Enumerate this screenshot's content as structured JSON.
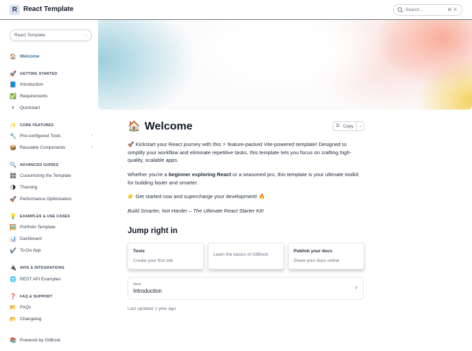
{
  "header": {
    "logo_letter": "R",
    "title": "React Template",
    "search_placeholder": "Search...",
    "search_shortcut": "⌘ K"
  },
  "sidebar": {
    "space_select": "React Template",
    "items": [
      {
        "icon": "🏠",
        "label": "Welcome",
        "type": "page",
        "active": true
      },
      {
        "icon": "🚀",
        "label": "GETTING STARTED",
        "type": "section"
      },
      {
        "icon": "📘",
        "label": "Introduction",
        "type": "page"
      },
      {
        "icon": "✅",
        "label": "Requirements",
        "type": "page"
      },
      {
        "icon": "⚡",
        "label": "Quickstart",
        "type": "page"
      },
      {
        "icon": "✨",
        "label": "CORE FEATURES",
        "type": "section"
      },
      {
        "icon": "🔧",
        "label": "Pre-configured Tools",
        "type": "page",
        "expandable": true
      },
      {
        "icon": "📦",
        "label": "Reusable Components",
        "type": "page",
        "expandable": true
      },
      {
        "icon": "🔍",
        "label": "ADVANCED GUIDES",
        "type": "section"
      },
      {
        "icon": "🎛️",
        "label": "Customizing the Template",
        "type": "page"
      },
      {
        "icon": "🌗",
        "label": "Theming",
        "type": "page"
      },
      {
        "icon": "🚀",
        "label": "Performance Optimization",
        "type": "page"
      },
      {
        "icon": "💡",
        "label": "EXAMPLES & USE CASES",
        "type": "section"
      },
      {
        "icon": "🖼️",
        "label": "Portfolio Template",
        "type": "page"
      },
      {
        "icon": "📊",
        "label": "Dashboard",
        "type": "page"
      },
      {
        "icon": "✔️",
        "label": "To-Do App",
        "type": "page"
      },
      {
        "icon": "🔌",
        "label": "APIS & INTEGRATIONS",
        "type": "section"
      },
      {
        "icon": "🌐",
        "label": "REST API Examples",
        "type": "page"
      },
      {
        "icon": "❓",
        "label": "FAQ & SUPPORT",
        "type": "section"
      },
      {
        "icon": "📂",
        "label": "FAQs",
        "type": "page"
      },
      {
        "icon": "📂",
        "label": "Changelog",
        "type": "page"
      }
    ],
    "powered_by": "Powered by GitBook",
    "powered_icon": "📚"
  },
  "main": {
    "title_icon": "🏠",
    "title": "Welcome",
    "copy_label": "Copy",
    "intro_part1": "🚀 Kickstart your React journey with this ⚡ feature-packed Vite-powered template! Designed to simplify your workflow and eliminate repetitive tasks, this template lets you focus on crafting high-quality, scalable apps.",
    "para2_a": "Whether you're a ",
    "para2_b": "beginner exploring React",
    "para2_c": " or a seasoned pro, this template is your ultimate toolkit for building faster and smarter.",
    "para3": "👉 Get started now and supercharge your development! 🔥",
    "para4": "Build Smarter, Not Harder – The Ultimate React Starter Kit!",
    "jump_heading": "Jump right in",
    "cards": [
      {
        "title": "Tools",
        "subtitle": "Create your first site"
      },
      {
        "title": "",
        "subtitle": "Learn the basics of GitBook"
      },
      {
        "title": "Publish your docs",
        "subtitle": "Share your docs online"
      }
    ],
    "next_label": "Next",
    "next_title": "Introduction",
    "last_updated": "Last updated 1 year ago"
  }
}
